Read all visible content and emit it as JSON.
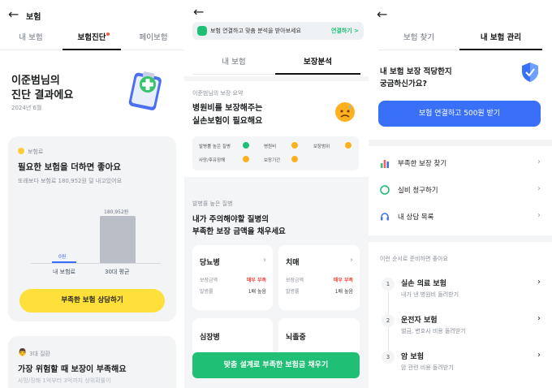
{
  "p1": {
    "back_icon": "arrow-left-icon",
    "title": "보험",
    "tabs": [
      "내 보험",
      "보험진단",
      "페이보험"
    ],
    "hero_title_1": "이준범님의",
    "hero_title_2": "진단 결과에요",
    "hero_date": "2024년 6월",
    "hero_icon": "clipboard-plus-icon",
    "card1_tag": "보험료",
    "card1_title": "필요한 보험을 더하면 좋아요",
    "card1_sub": "또래보다 보험료 180,952원 덜 내고있어요",
    "bar_mine_value": "0원",
    "bar_avg_value": "180,952원",
    "bar_mine_label": "내 보험료",
    "bar_avg_label": "30대 평균",
    "card1_button": "부족한 보험 상담하기",
    "card2_tag": "3대 질환",
    "card2_title": "가장 위험할 때 보장이 부족해요",
    "card2_sub": "사망/장해 1억부터 3억까지 상위확률이",
    "colors": {
      "yellow": "#ffe03a",
      "bar": "#b9bec7",
      "bar_blue": "#3b6cff"
    }
  },
  "p2": {
    "back_icon": "arrow-left-icon",
    "banner_text": "보험 연결하고 맞춤 분석을 받아보세요",
    "banner_link": "연결하기 >",
    "tabs": [
      "내 보험",
      "보장분석"
    ],
    "summary_label": "이준범님의 보장 요약",
    "summary_title_1": "병원비를 보장해주는",
    "summary_title_2": "실손보험이 필요해요",
    "status_items": [
      {
        "label": "발병률 높은 질병",
        "status": "ok"
      },
      {
        "label": "병원비",
        "status": "warn"
      },
      {
        "label": "보장범위",
        "status": "warn"
      },
      {
        "label": "사망/후유장해",
        "status": "warn"
      },
      {
        "label": "보장기간",
        "status": "warn"
      }
    ],
    "section_label": "발병률 높은 질병",
    "section_title_1": "내가 주의해야할 질병의",
    "section_title_2": "부족한 보장 금액을 채우세요",
    "disease_cards": [
      {
        "name": "당뇨병",
        "k1": "보장금액",
        "v1": "매우 부족",
        "k2": "발병률",
        "v2": "1배 높음"
      },
      {
        "name": "치매",
        "k1": "보장금액",
        "v1": "매우 부족",
        "k2": "발병률",
        "v2": "1배 높음"
      },
      {
        "name": "심장병"
      },
      {
        "name": "뇌졸중"
      }
    ],
    "cta_button": "맞춤 설계로 부족한 보험금 채우기",
    "colors": {
      "green": "#1fbf75",
      "red": "#f0443a",
      "orange": "#ffb020"
    }
  },
  "p3": {
    "back_icon": "arrow-left-icon",
    "tabs": [
      "보험 찾기",
      "내 보험 관리"
    ],
    "q_line_1": "내 보험 보장 적당한지",
    "q_line_2": "궁금하신가요?",
    "shield_icon": "shield-check-icon",
    "connect_button": "보험 연결하고 500원 받기",
    "menu": [
      {
        "icon": "bar-chart-icon",
        "label": "부족한 보장 찾기"
      },
      {
        "icon": "refresh-icon",
        "label": "실비 청구하기"
      },
      {
        "icon": "headset-icon",
        "label": "내 상담 목록"
      }
    ],
    "steps_label": "이런 순서로 준비하면 좋아요",
    "steps": [
      {
        "num": "1",
        "title": "실손 의료 보험",
        "sub": "내가 낸 병원비 돌려받기"
      },
      {
        "num": "2",
        "title": "운전자 보험",
        "sub": "벌금, 변호사 비용 돌려받기"
      },
      {
        "num": "3",
        "title": "암 보험",
        "sub": "암 관련 비용 돌려받기"
      }
    ],
    "colors": {
      "blue": "#3a6ff7"
    }
  }
}
